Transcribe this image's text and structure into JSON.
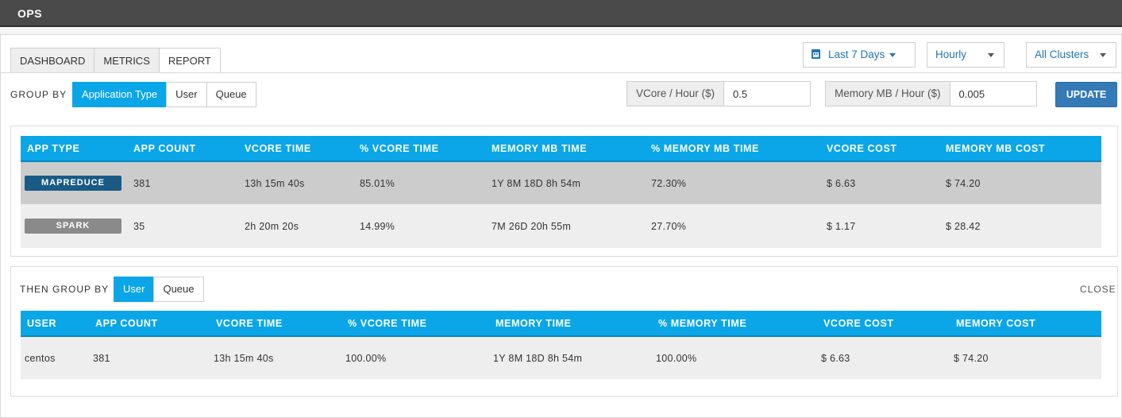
{
  "header": {
    "title": "OPS"
  },
  "tabs": [
    {
      "label": "DASHBOARD"
    },
    {
      "label": "METRICS"
    },
    {
      "label": "REPORT"
    }
  ],
  "filters": {
    "range": "Last 7 Days",
    "interval": "Hourly",
    "clusters": "All Clusters"
  },
  "group_by": {
    "label": "GROUP BY",
    "options": [
      "Application Type",
      "User",
      "Queue"
    ],
    "selected": "Application Type"
  },
  "pricing": {
    "vcore_label": "VCore / Hour ($)",
    "vcore_value": "0.5",
    "memory_label": "Memory MB / Hour ($)",
    "memory_value": "0.005",
    "update_label": "UPDATE"
  },
  "app_table": {
    "columns": [
      "APP TYPE",
      "APP COUNT",
      "VCORE TIME",
      "% VCORE TIME",
      "MEMORY MB TIME",
      "% MEMORY MB TIME",
      "VCORE COST",
      "MEMORY MB COST"
    ],
    "rows": [
      {
        "type": "MAPREDUCE",
        "count": "381",
        "vcore_time": "13h 15m 40s",
        "pct_vcore": "85.01%",
        "mem_time": "1Y 8M 18D 8h 54m",
        "pct_mem": "72.30%",
        "vcore_cost": "$ 6.63",
        "mem_cost": "$ 74.20",
        "badge_color": "#1a5b86"
      },
      {
        "type": "SPARK",
        "count": "35",
        "vcore_time": "2h 20m 20s",
        "pct_vcore": "14.99%",
        "mem_time": "7M 26D 20h 55m",
        "pct_mem": "27.70%",
        "vcore_cost": "$ 1.17",
        "mem_cost": "$ 28.42",
        "badge_color": "#8a8a8a"
      }
    ]
  },
  "then_group_by": {
    "label": "THEN GROUP BY",
    "options": [
      "User",
      "Queue"
    ],
    "selected": "User",
    "close_label": "CLOSE"
  },
  "user_table": {
    "columns": [
      "USER",
      "APP COUNT",
      "VCORE TIME",
      "% VCORE TIME",
      "MEMORY TIME",
      "% MEMORY TIME",
      "VCORE COST",
      "MEMORY COST"
    ],
    "rows": [
      {
        "user": "centos",
        "count": "381",
        "vcore_time": "13h 15m 40s",
        "pct_vcore": "100.00%",
        "mem_time": "1Y 8M 18D 8h 54m",
        "pct_mem": "100.00%",
        "vcore_cost": "$ 6.63",
        "mem_cost": "$ 74.20"
      }
    ]
  },
  "colors": {
    "accent": "#0aa6e8",
    "primary": "#337ab7",
    "topbar": "#4a4a4a"
  }
}
